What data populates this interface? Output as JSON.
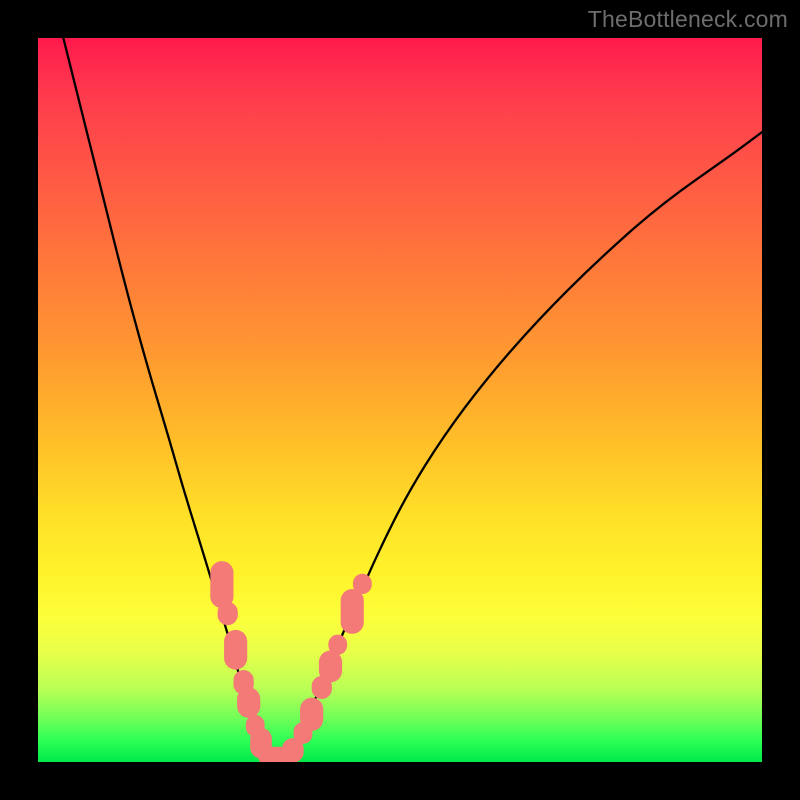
{
  "watermark": {
    "text": "TheBottleneck.com"
  },
  "colors": {
    "background": "#000000",
    "curve": "#000000",
    "marker_fill": "#f37a76",
    "gradient_top": "#ff1a4d",
    "gradient_bottom": "#00e84a"
  },
  "chart_data": {
    "type": "line",
    "title": "",
    "xlabel": "",
    "ylabel": "",
    "xlim": [
      0,
      100
    ],
    "ylim": [
      0,
      100
    ],
    "grid": false,
    "legend": false,
    "series": [
      {
        "name": "left-branch",
        "x": [
          3.5,
          6,
          9,
          12,
          15,
          18,
          20,
          22,
          24,
          25.5,
          27,
          28.3,
          29.6,
          31,
          32.5
        ],
        "values": [
          100,
          90,
          78,
          66,
          55,
          45,
          38,
          31.5,
          25,
          20,
          15,
          10,
          6,
          2.5,
          0
        ]
      },
      {
        "name": "right-branch",
        "x": [
          34.5,
          36,
          38,
          40.5,
          43.5,
          47,
          51,
          56,
          62,
          69,
          77,
          86,
          96,
          100
        ],
        "values": [
          0,
          3,
          8,
          14,
          21,
          29,
          37,
          45,
          53,
          61,
          69,
          77,
          84,
          87
        ]
      }
    ],
    "markers": {
      "name": "data-points",
      "shape": "rounded-rect",
      "color": "#f37a76",
      "points": [
        {
          "x": 25.4,
          "y": 24.5,
          "w": 3.2,
          "h": 6.5
        },
        {
          "x": 26.2,
          "y": 20.5,
          "w": 2.8,
          "h": 3.2
        },
        {
          "x": 27.3,
          "y": 15.5,
          "w": 3.2,
          "h": 5.5
        },
        {
          "x": 28.4,
          "y": 11.0,
          "w": 2.8,
          "h": 3.4
        },
        {
          "x": 29.1,
          "y": 8.2,
          "w": 3.2,
          "h": 4.2
        },
        {
          "x": 30.0,
          "y": 5.0,
          "w": 2.6,
          "h": 3.0
        },
        {
          "x": 30.8,
          "y": 2.6,
          "w": 3.0,
          "h": 4.2
        },
        {
          "x": 32.8,
          "y": 0.8,
          "w": 4.8,
          "h": 2.6
        },
        {
          "x": 35.2,
          "y": 1.6,
          "w": 3.0,
          "h": 3.4
        },
        {
          "x": 36.6,
          "y": 4.0,
          "w": 2.6,
          "h": 3.0
        },
        {
          "x": 37.8,
          "y": 6.6,
          "w": 3.2,
          "h": 4.6
        },
        {
          "x": 39.2,
          "y": 10.3,
          "w": 2.8,
          "h": 3.2
        },
        {
          "x": 40.4,
          "y": 13.2,
          "w": 3.2,
          "h": 4.4
        },
        {
          "x": 41.4,
          "y": 16.2,
          "w": 2.6,
          "h": 2.8
        },
        {
          "x": 43.4,
          "y": 20.8,
          "w": 3.2,
          "h": 6.2
        },
        {
          "x": 44.8,
          "y": 24.6,
          "w": 2.6,
          "h": 2.8
        }
      ]
    }
  }
}
